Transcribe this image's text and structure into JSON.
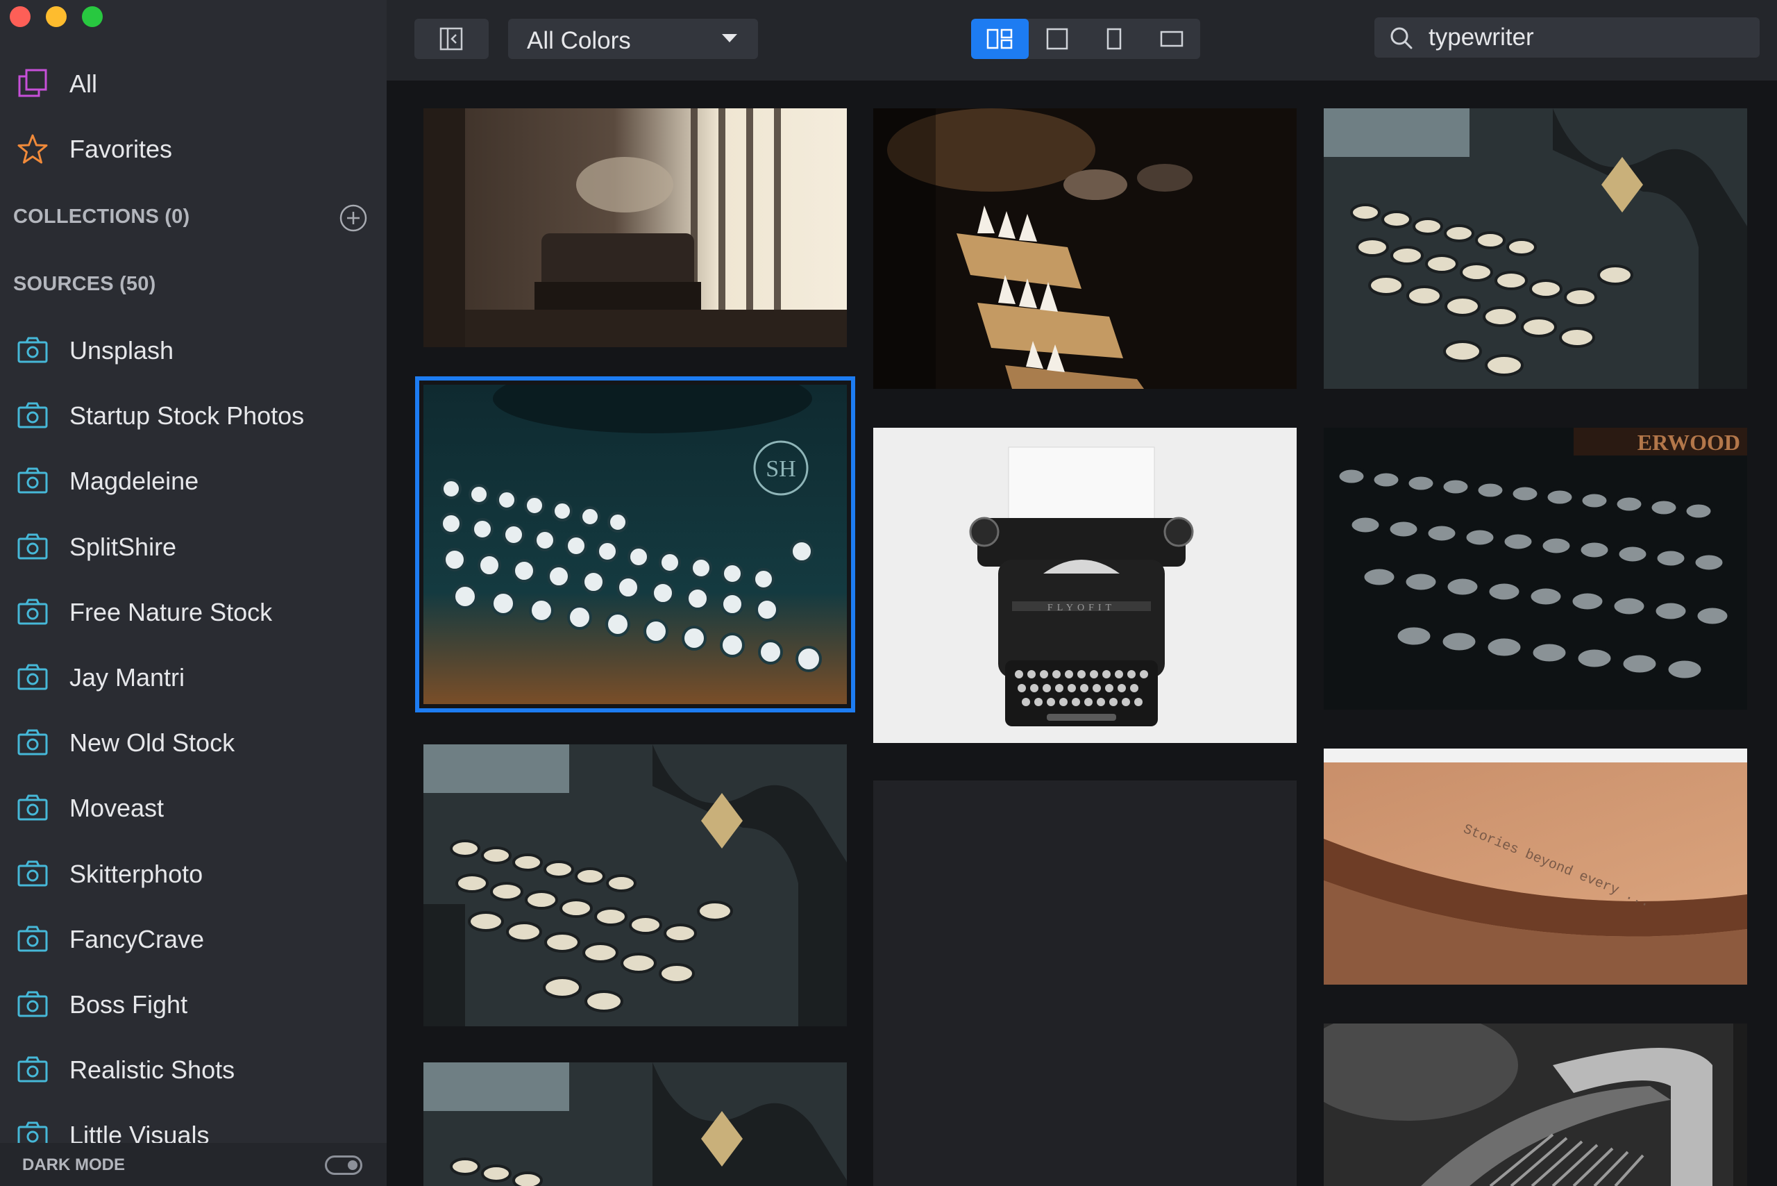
{
  "sidebar": {
    "all_label": "All",
    "favorites_label": "Favorites",
    "collections_header": "COLLECTIONS (0)",
    "sources_header": "SOURCES (50)",
    "sources": [
      "Unsplash",
      "Startup Stock Photos",
      "Magdeleine",
      "SplitShire",
      "Free Nature Stock",
      "Jay Mantri",
      "New Old Stock",
      "Moveast",
      "Skitterphoto",
      "FancyCrave",
      "Boss Fight",
      "Realistic Shots",
      "Little Visuals"
    ],
    "dark_mode_label": "DARK MODE",
    "dark_mode_on": true
  },
  "toolbar": {
    "color_filter": "All Colors",
    "view_modes": [
      "grid",
      "square",
      "portrait",
      "landscape"
    ],
    "active_view": "grid",
    "search_value": "typewriter"
  },
  "colors": {
    "accent": "#1d7cf2",
    "sidebar_bg": "#2a2c32",
    "grid_bg": "#141518",
    "all_icon": "#c64fd8",
    "favorites_icon": "#f08a3a",
    "source_icon": "#46b8d8"
  },
  "photos": [
    {
      "subject": "typewriter by window (sepia)"
    },
    {
      "subject": "typebars close-up (warm)"
    },
    {
      "subject": "vintage typewriter keys (teal)"
    },
    {
      "subject": "typewriter keyboard",
      "selected": true
    },
    {
      "subject": "typewriter top view on white"
    },
    {
      "subject": "Underwood keys (dark)"
    },
    {
      "subject": "vintage typewriter keys (teal)"
    },
    {
      "subject": "empty"
    },
    {
      "subject": "typed paper on roller"
    },
    {
      "subject": "vintage typewriter keys (teal)"
    },
    {
      "subject": "typewriter detail (monochrome)"
    }
  ]
}
